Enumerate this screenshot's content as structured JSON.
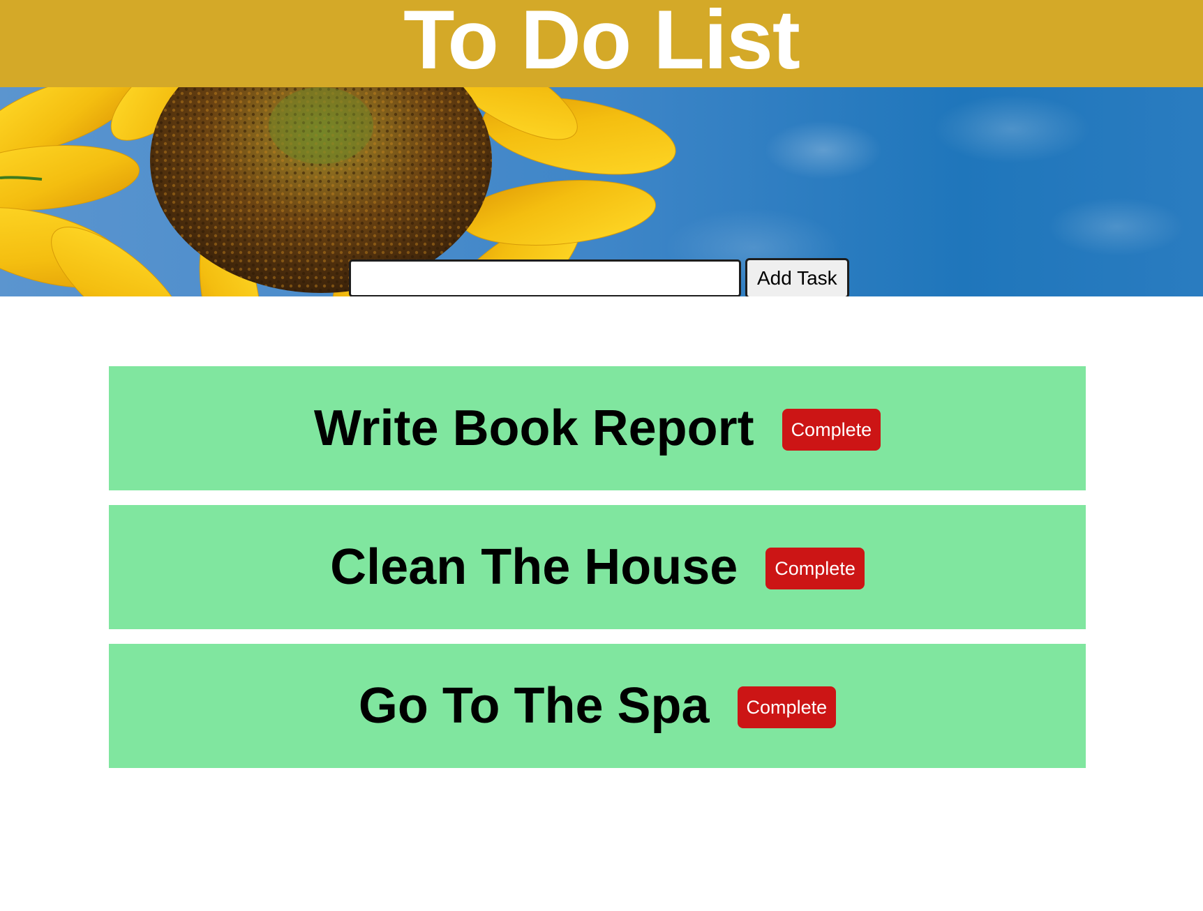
{
  "header": {
    "title": "To Do List",
    "background_color": "#d4a928"
  },
  "hero": {
    "image": "sunflower-against-blue-sky"
  },
  "add_form": {
    "input_value": "",
    "input_placeholder": "",
    "button_label": "Add Task"
  },
  "tasks": [
    {
      "text": "Write Book Report",
      "button_label": "Complete"
    },
    {
      "text": "Clean The House",
      "button_label": "Complete"
    },
    {
      "text": "Go To The Spa",
      "button_label": "Complete"
    }
  ],
  "colors": {
    "task_background": "#80e69f",
    "complete_button": "#cc1515"
  }
}
